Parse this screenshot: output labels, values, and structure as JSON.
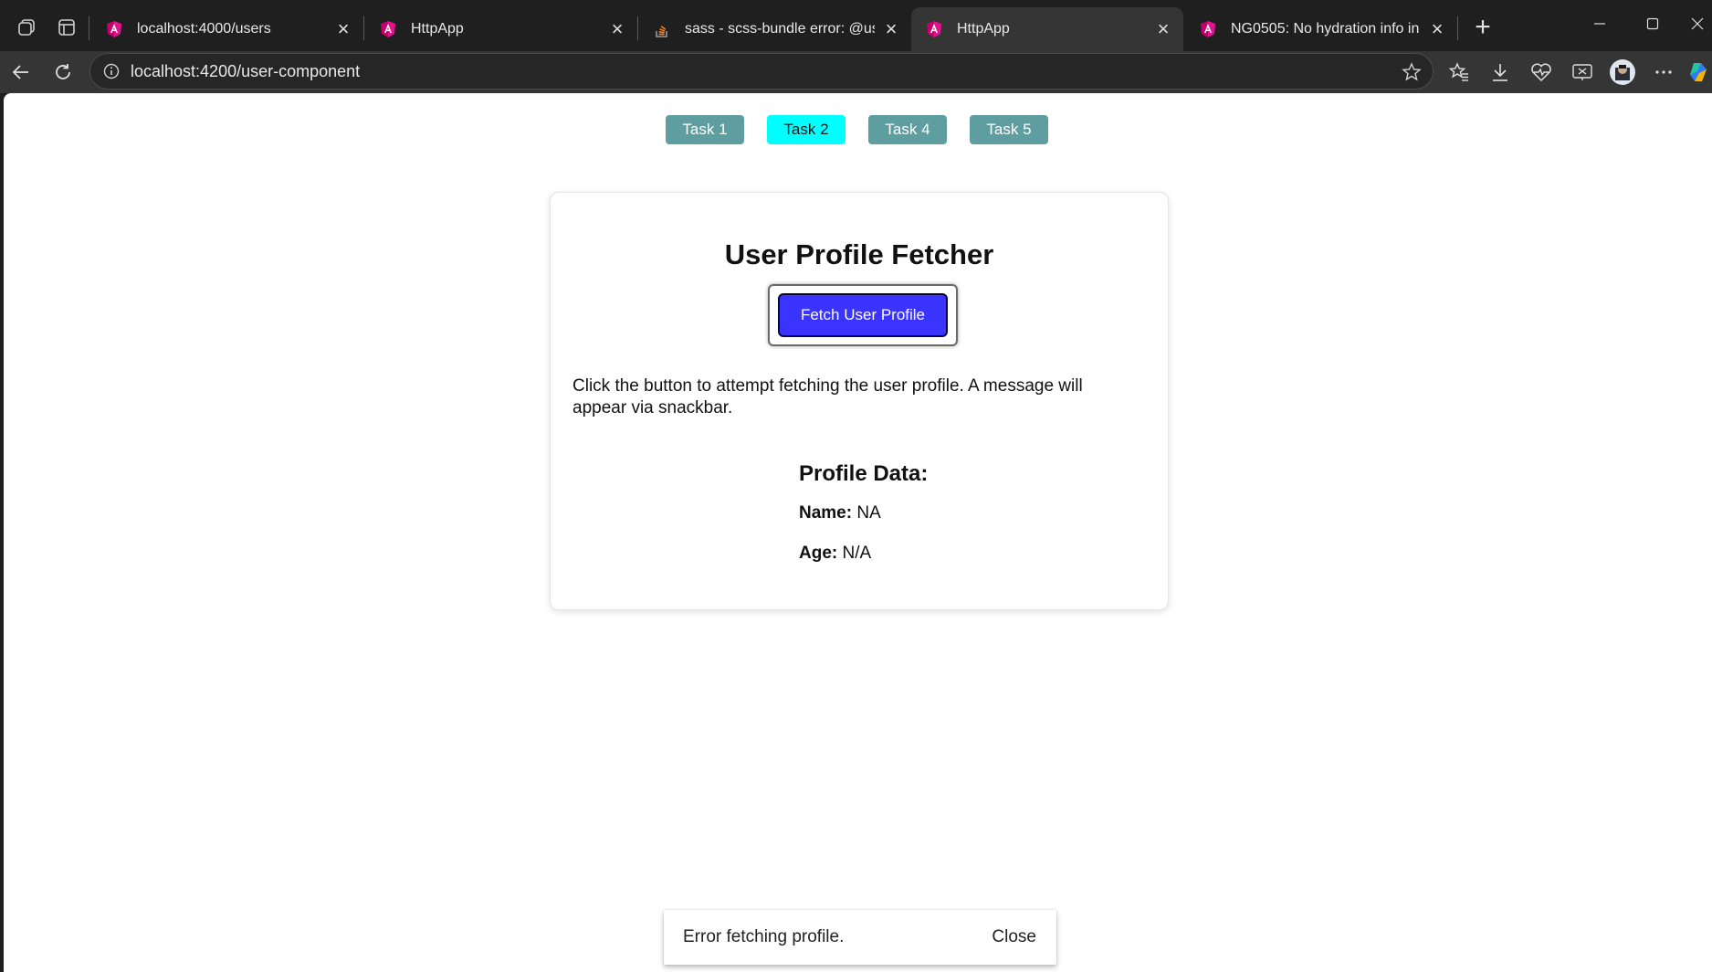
{
  "browser": {
    "tabs": [
      {
        "title": "localhost:4000/users",
        "favicon": "angular-icon",
        "active": false
      },
      {
        "title": "HttpApp",
        "favicon": "angular-icon",
        "active": false
      },
      {
        "title": "sass - scss-bundle error: @use rul",
        "favicon": "stackoverflow-icon",
        "active": false
      },
      {
        "title": "HttpApp",
        "favicon": "angular-icon",
        "active": true
      },
      {
        "title": "NG0505: No hydration info in serv",
        "favicon": "angular-icon",
        "active": false
      }
    ],
    "address": "localhost:4200/user-component"
  },
  "app": {
    "nav": [
      {
        "label": "Task 1",
        "active": false
      },
      {
        "label": "Task 2",
        "active": true
      },
      {
        "label": "Task 4",
        "active": false
      },
      {
        "label": "Task 5",
        "active": false
      }
    ],
    "card": {
      "title": "User Profile Fetcher",
      "button_label": "Fetch User Profile",
      "description": "Click the button to attempt fetching the user profile. A message will appear via snackbar.",
      "profile_heading": "Profile Data:",
      "name_label": "Name:",
      "name_value": "NA",
      "age_label": "Age:",
      "age_value": "N/A"
    },
    "snackbar": {
      "message": "Error fetching profile.",
      "action": "Close"
    }
  },
  "colors": {
    "nav_default": "#5f9ea0",
    "nav_active": "#00ffff",
    "fetch_button": "#3b34ff"
  }
}
